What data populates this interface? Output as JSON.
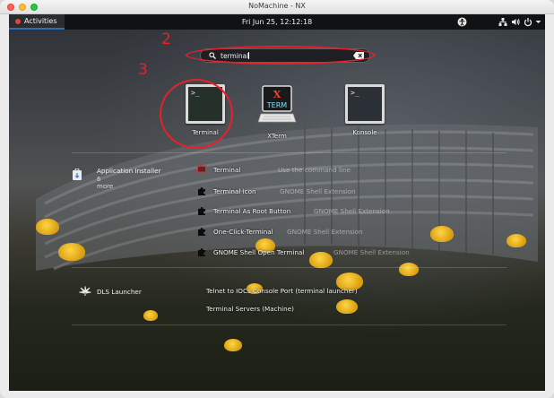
{
  "window": {
    "title": "NoMachine - NX"
  },
  "topbar": {
    "activities_label": "Activities",
    "clock": "Fri Jun 25, 12:12:18",
    "tray_icons": [
      "accessibility-icon",
      "network-icon",
      "volume-icon",
      "power-icon",
      "chevron-down-icon"
    ]
  },
  "search": {
    "query": "terminal"
  },
  "annotations": {
    "step_2": "2",
    "step_3": "3"
  },
  "apps": [
    {
      "name": "Terminal",
      "icon": "terminal-icon",
      "glyph": ">_"
    },
    {
      "name": "XTerm",
      "icon": "xterm-icon",
      "glyph_x": "X",
      "glyph_term": "TERM"
    },
    {
      "name": "Konsole",
      "icon": "konsole-icon",
      "glyph": ">_"
    }
  ],
  "providers": [
    {
      "name": "Application Installer",
      "sub": "6 more",
      "icon": "app-installer-icon",
      "results": [
        {
          "name": "Terminal",
          "desc": "Use the command line",
          "icon": "terminal-small-icon"
        },
        {
          "name": "Terminal icon",
          "desc": "GNOME Shell Extension",
          "icon": "puzzle-icon"
        },
        {
          "name": "Terminal As Root Button",
          "desc": "GNOME Shell Extension",
          "icon": "puzzle-icon"
        },
        {
          "name": "One-Click-Terminal",
          "desc": "GNOME Shell Extension",
          "icon": "puzzle-icon"
        },
        {
          "name": "GNOME Shell Open Terminal",
          "desc": "GNOME Shell Extension",
          "icon": "puzzle-icon"
        }
      ]
    },
    {
      "name": "DLS Launcher",
      "icon": "cannabis-leaf-icon",
      "results": [
        {
          "name": "Telnet to IOCs Console Port (terminal launcher)"
        },
        {
          "name": "Terminal Servers (Machine)"
        }
      ]
    }
  ],
  "colors": {
    "annotation": "#e8202a",
    "accent": "#2f6fb0",
    "topbar": "#111214"
  }
}
